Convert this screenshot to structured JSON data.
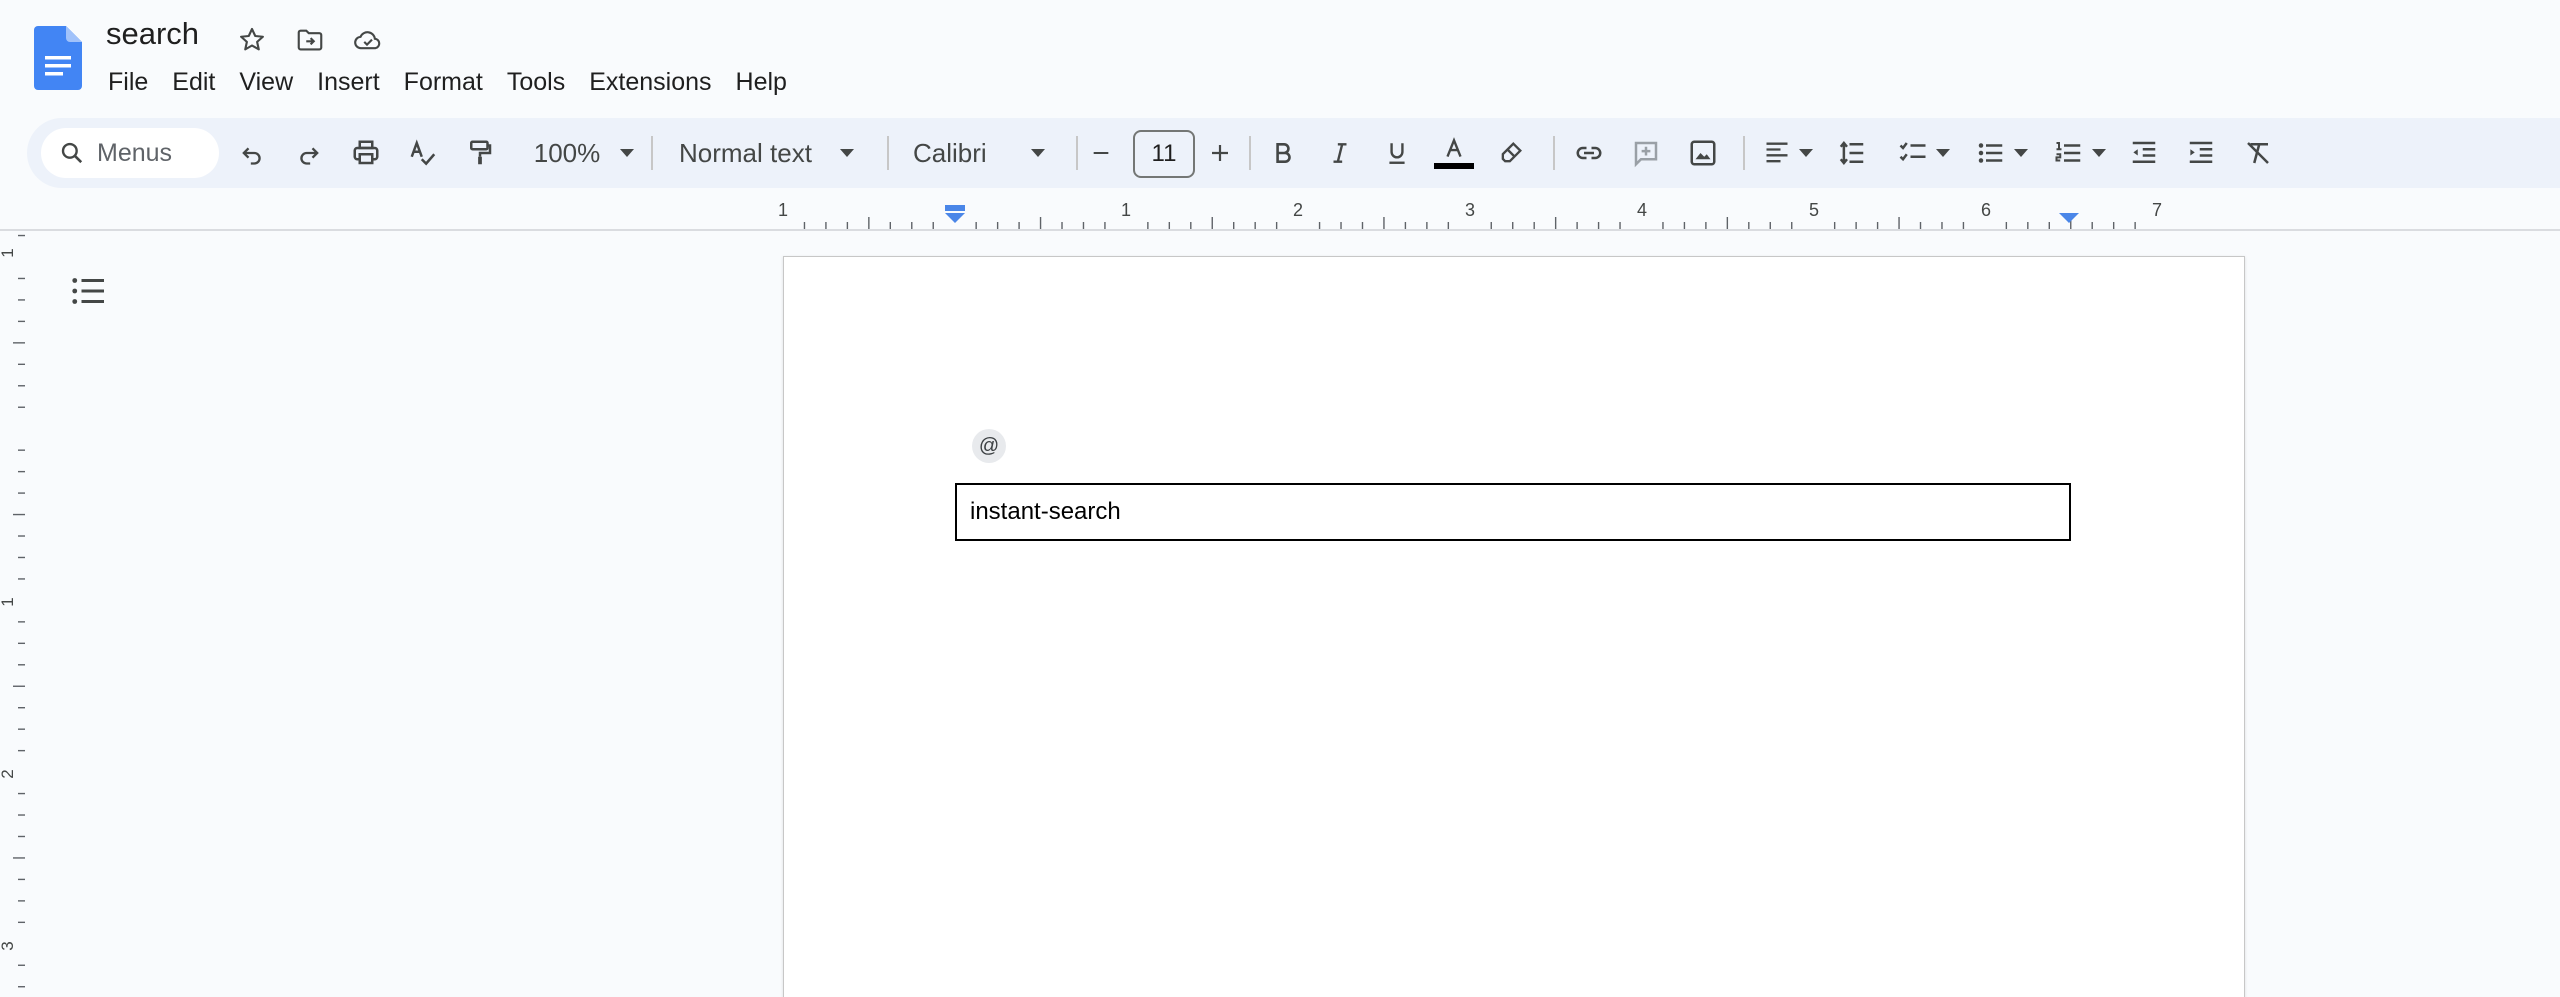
{
  "document": {
    "title": "search"
  },
  "menubar": {
    "items": [
      "File",
      "Edit",
      "View",
      "Insert",
      "Format",
      "Tools",
      "Extensions",
      "Help"
    ]
  },
  "toolbar": {
    "search_placeholder": "Menus",
    "zoom": "100%",
    "paragraph_style": "Normal text",
    "font": "Calibri",
    "font_size": "11",
    "text_color": "#000000"
  },
  "ruler": {
    "horizontal_labels": [
      "1",
      "1",
      "2",
      "3",
      "4",
      "5",
      "6",
      "7"
    ],
    "vertical_labels": [
      "1",
      "1",
      "2",
      "3"
    ]
  },
  "page": {
    "at_chip": "@",
    "table_cell_text": "instant-search"
  },
  "colors": {
    "brand_blue": "#4285f4",
    "toolbar_bg": "#edf2fa",
    "ruler_marker": "#4a86e8"
  },
  "icons": {
    "logo": "google-docs-icon",
    "star": "star-icon",
    "move": "folder-move-icon",
    "cloud": "cloud-saved-icon",
    "outline": "document-outline-icon"
  }
}
